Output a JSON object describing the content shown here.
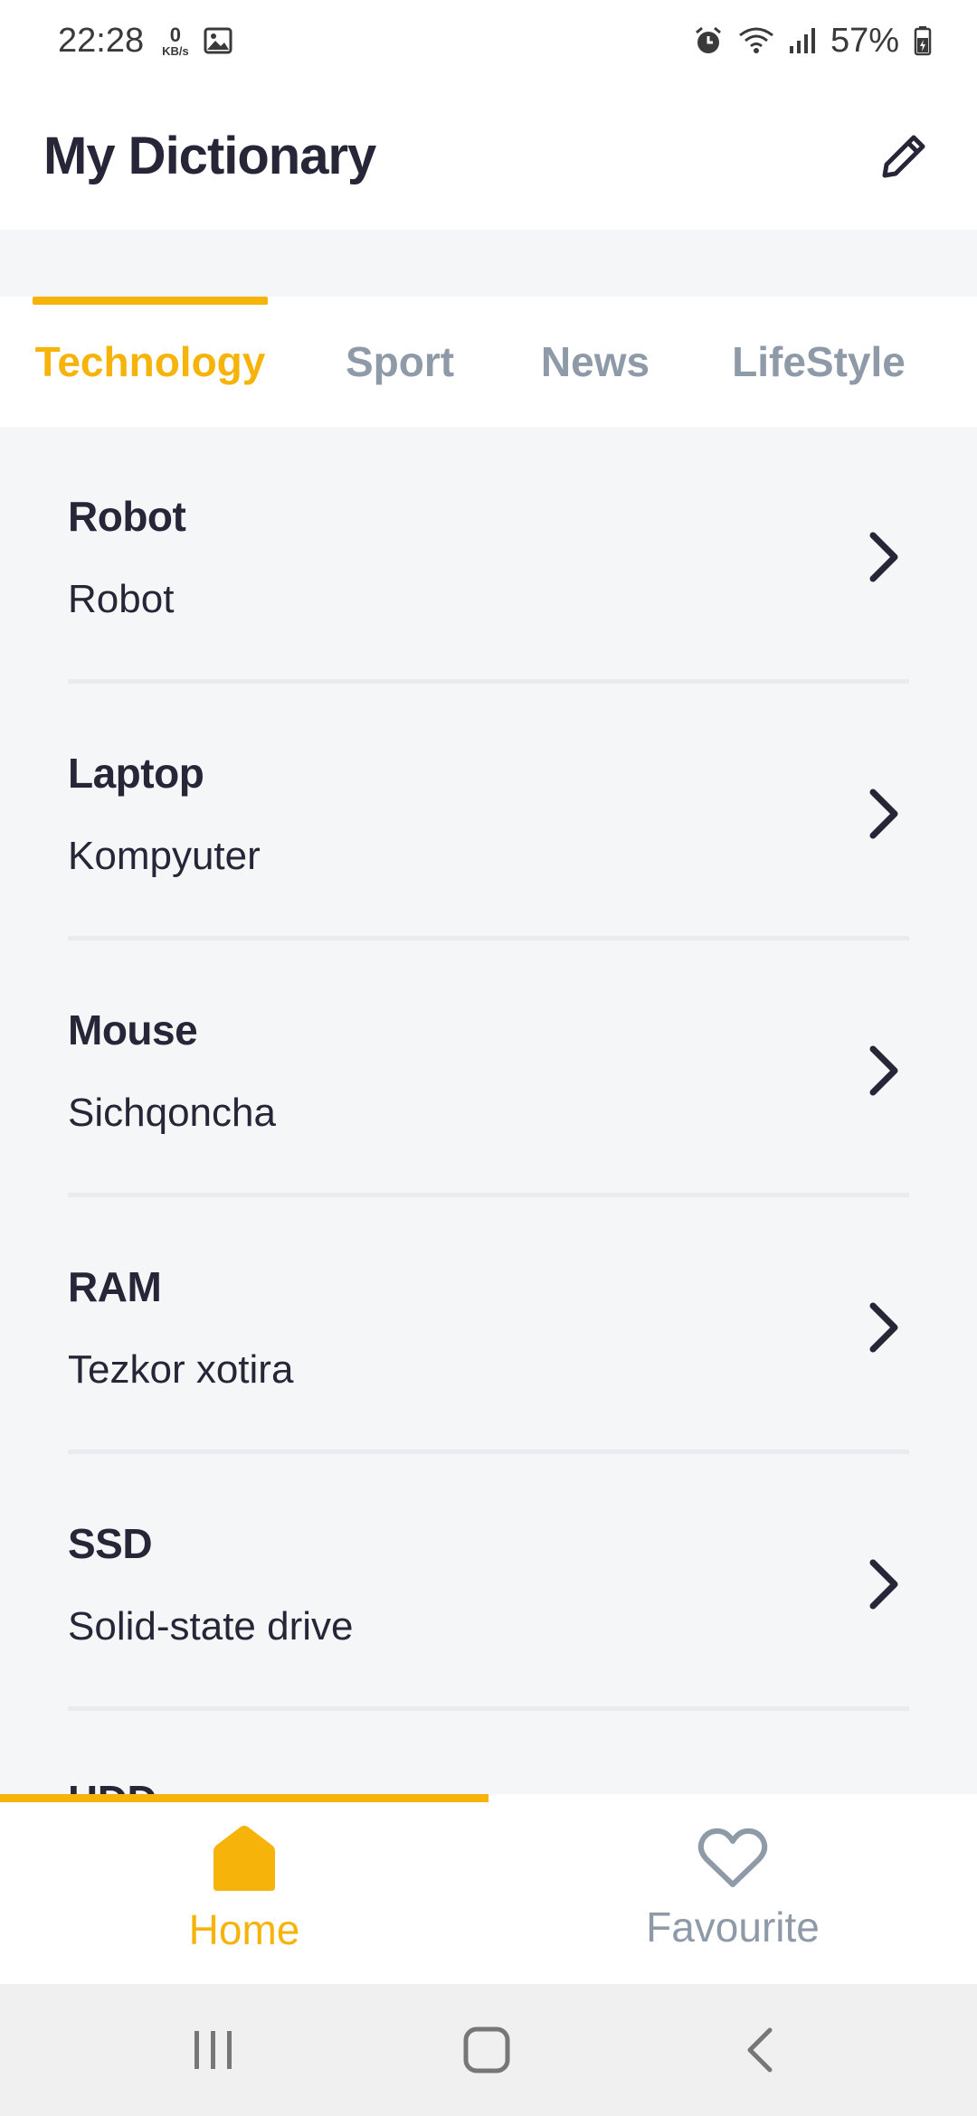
{
  "status_bar": {
    "time": "22:28",
    "net_speed_value": "0",
    "net_speed_unit": "KB/s",
    "battery": "57%",
    "icons": [
      "image-icon",
      "alarm-icon",
      "wifi-icon",
      "signal-icon",
      "battery-icon"
    ]
  },
  "header": {
    "title": "My Dictionary",
    "edit_icon": "pencil-icon"
  },
  "tabs": [
    {
      "label": "Technology",
      "active": true
    },
    {
      "label": "Sport",
      "active": false
    },
    {
      "label": "News",
      "active": false
    },
    {
      "label": "LifeStyle",
      "active": false
    }
  ],
  "words": [
    {
      "word": "Robot",
      "translation": "Robot"
    },
    {
      "word": "Laptop",
      "translation": "Kompyuter"
    },
    {
      "word": "Mouse",
      "translation": "Sichqoncha"
    },
    {
      "word": "RAM",
      "translation": "Tezkor xotira"
    },
    {
      "word": "SSD",
      "translation": "Solid-state drive"
    },
    {
      "word": "HDD",
      "translation": ""
    }
  ],
  "bottom_nav": {
    "home_label": "Home",
    "favourite_label": "Favourite",
    "active": "home"
  },
  "colors": {
    "accent": "#f6b30a",
    "text": "#262638",
    "muted": "#8e9aa8",
    "background": "#f5f6f8"
  }
}
